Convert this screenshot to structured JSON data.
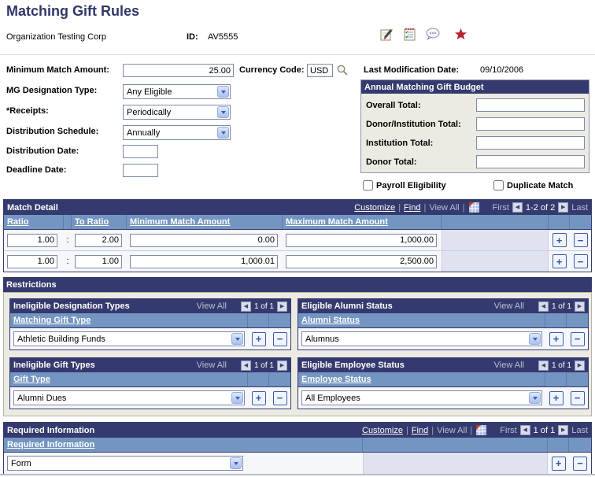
{
  "page": {
    "title": "Matching Gift Rules"
  },
  "header": {
    "org_name": "Organization Testing Corp",
    "id_label": "ID:",
    "id_value": "AV5555",
    "icons": [
      "edit-note-icon",
      "checklist-icon",
      "comment-icon",
      "favorite-star-icon",
      "search-icon"
    ]
  },
  "form": {
    "min_match_label": "Minimum Match Amount:",
    "min_match_value": "25.00",
    "currency_label": "Currency Code:",
    "currency_value": "USD",
    "mg_designation_label": "MG Designation Type:",
    "mg_designation_value": "Any Eligible",
    "receipts_label": "*Receipts:",
    "receipts_value": "Periodically",
    "dist_schedule_label": "Distribution Schedule:",
    "dist_schedule_value": "Annually",
    "dist_date_label": "Distribution Date:",
    "dist_date_value": "",
    "deadline_label": "Deadline Date:",
    "deadline_value": "",
    "last_mod_label": "Last Modification Date:",
    "last_mod_value": "09/10/2006"
  },
  "budget": {
    "title": "Annual Matching Gift Budget",
    "fields": [
      {
        "label": "Overall Total:",
        "value": ""
      },
      {
        "label": "Donor/Institution Total:",
        "value": ""
      },
      {
        "label": "Institution Total:",
        "value": ""
      },
      {
        "label": "Donor Total:",
        "value": ""
      }
    ]
  },
  "checkboxes": {
    "payroll": "Payroll Eligibility",
    "duplicate": "Duplicate Match"
  },
  "toolbar": {
    "customize": "Customize",
    "find": "Find",
    "view_all": "View All",
    "first": "First",
    "last": "Last",
    "pipe": "|"
  },
  "colors": {
    "navy_bar": "#353a6e",
    "column_header_blue": "#7495c1",
    "group_background": "#ecebe3",
    "filler_cell": "#e0e3ef",
    "star_red": "#b5242c"
  },
  "match_detail": {
    "title": "Match Detail",
    "range": "1-2 of 2",
    "separator": ":",
    "columns": {
      "ratio": "Ratio",
      "to_ratio": "To Ratio",
      "min": "Minimum Match Amount",
      "max": "Maximum Match Amount"
    },
    "rows": [
      {
        "ratio": "1.00",
        "to_ratio": "2.00",
        "min": "0.00",
        "max": "1,000.00"
      },
      {
        "ratio": "1.00",
        "to_ratio": "1.00",
        "min": "1,000.01",
        "max": "2,500.00"
      }
    ]
  },
  "restrictions": {
    "title": "Restrictions",
    "grids": [
      {
        "title": "Ineligible Designation Types",
        "range": "1 of 1",
        "column": "Matching Gift Type",
        "value": "Athletic Building Funds"
      },
      {
        "title": "Eligible Alumni Status",
        "range": "1 of 1",
        "column": "Alumni Status",
        "value": "Alumnus"
      },
      {
        "title": "Ineligible Gift Types",
        "range": "1 of 1",
        "column": "Gift Type",
        "value": "Alumni Dues"
      },
      {
        "title": "Eligible Employee Status",
        "range": "1 of 1",
        "column": "Employee Status",
        "value": "All Employees"
      }
    ]
  },
  "required_info": {
    "title": "Required Information",
    "range": "1 of 1",
    "column": "Required Information",
    "value": "Form"
  }
}
